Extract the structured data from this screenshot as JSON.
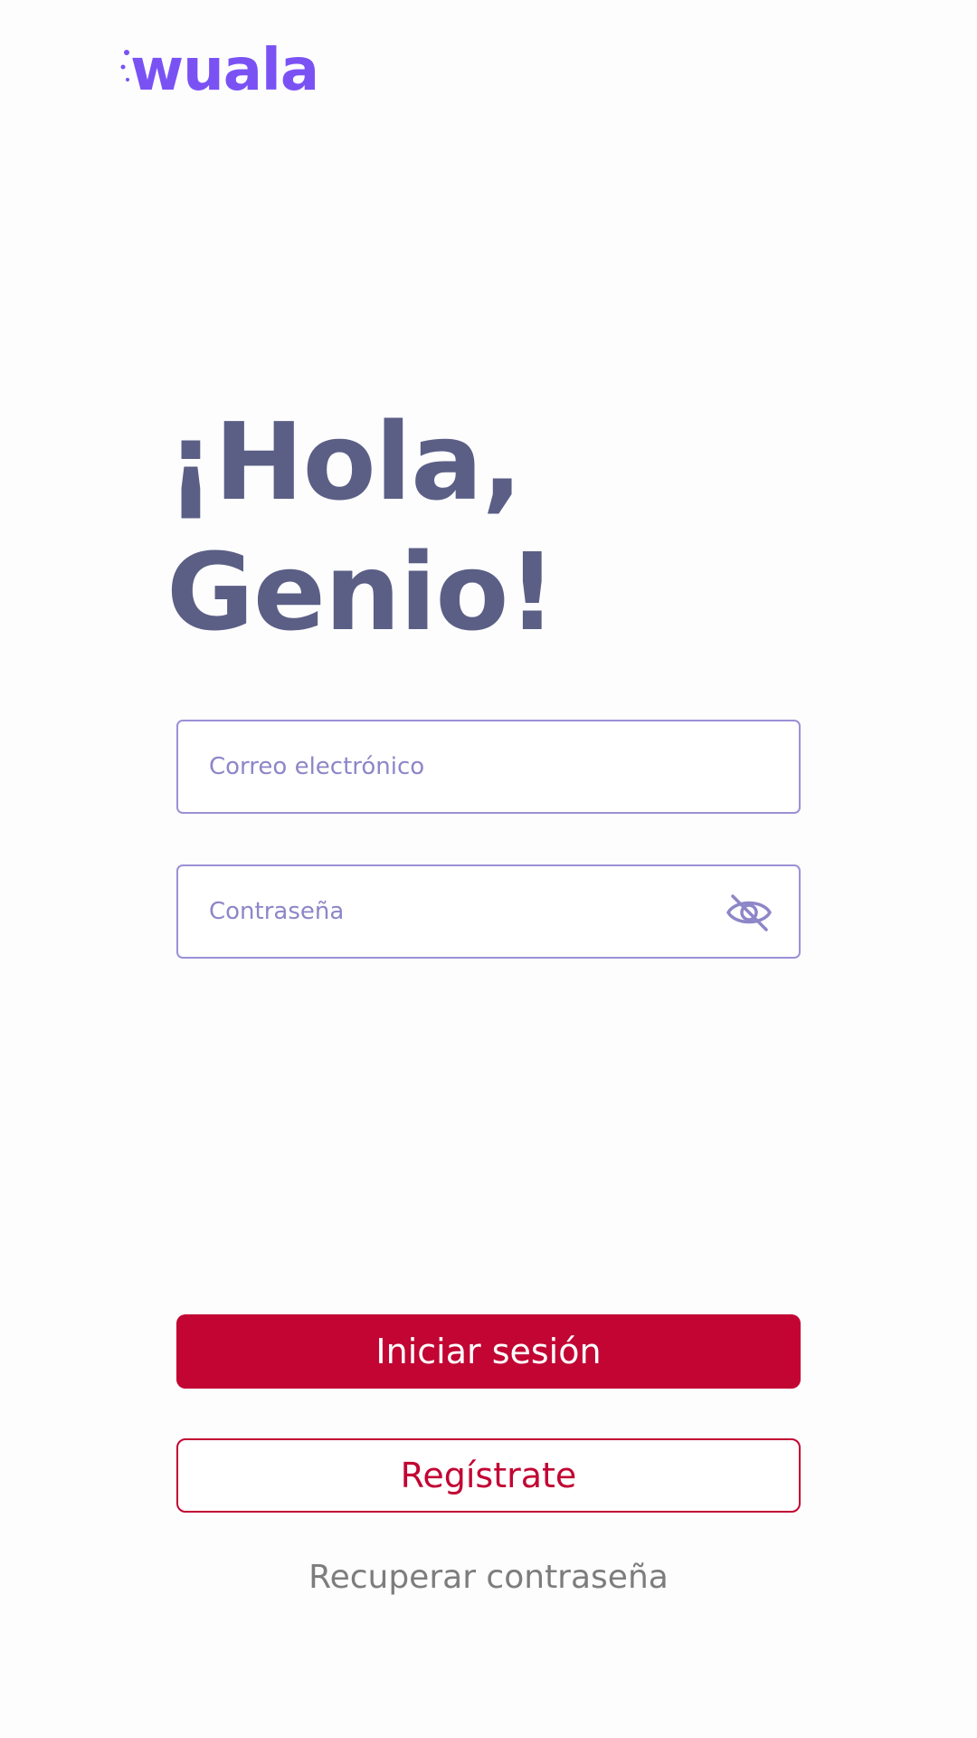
{
  "brand": {
    "name": "wuala",
    "color": "#7a52f4"
  },
  "greeting": {
    "line1": "¡Hola,",
    "line2": "Genio!"
  },
  "form": {
    "email_placeholder": "Correo electrónico",
    "password_placeholder": "Contraseña",
    "password_toggle_icon": "eye-off-icon"
  },
  "actions": {
    "login_label": "Iniciar sesión",
    "register_label": "Regístrate",
    "recover_label": "Recuperar contraseña"
  },
  "colors": {
    "primary": "#c20533",
    "heading": "#5b5f85",
    "field_border": "#9a91d6"
  }
}
